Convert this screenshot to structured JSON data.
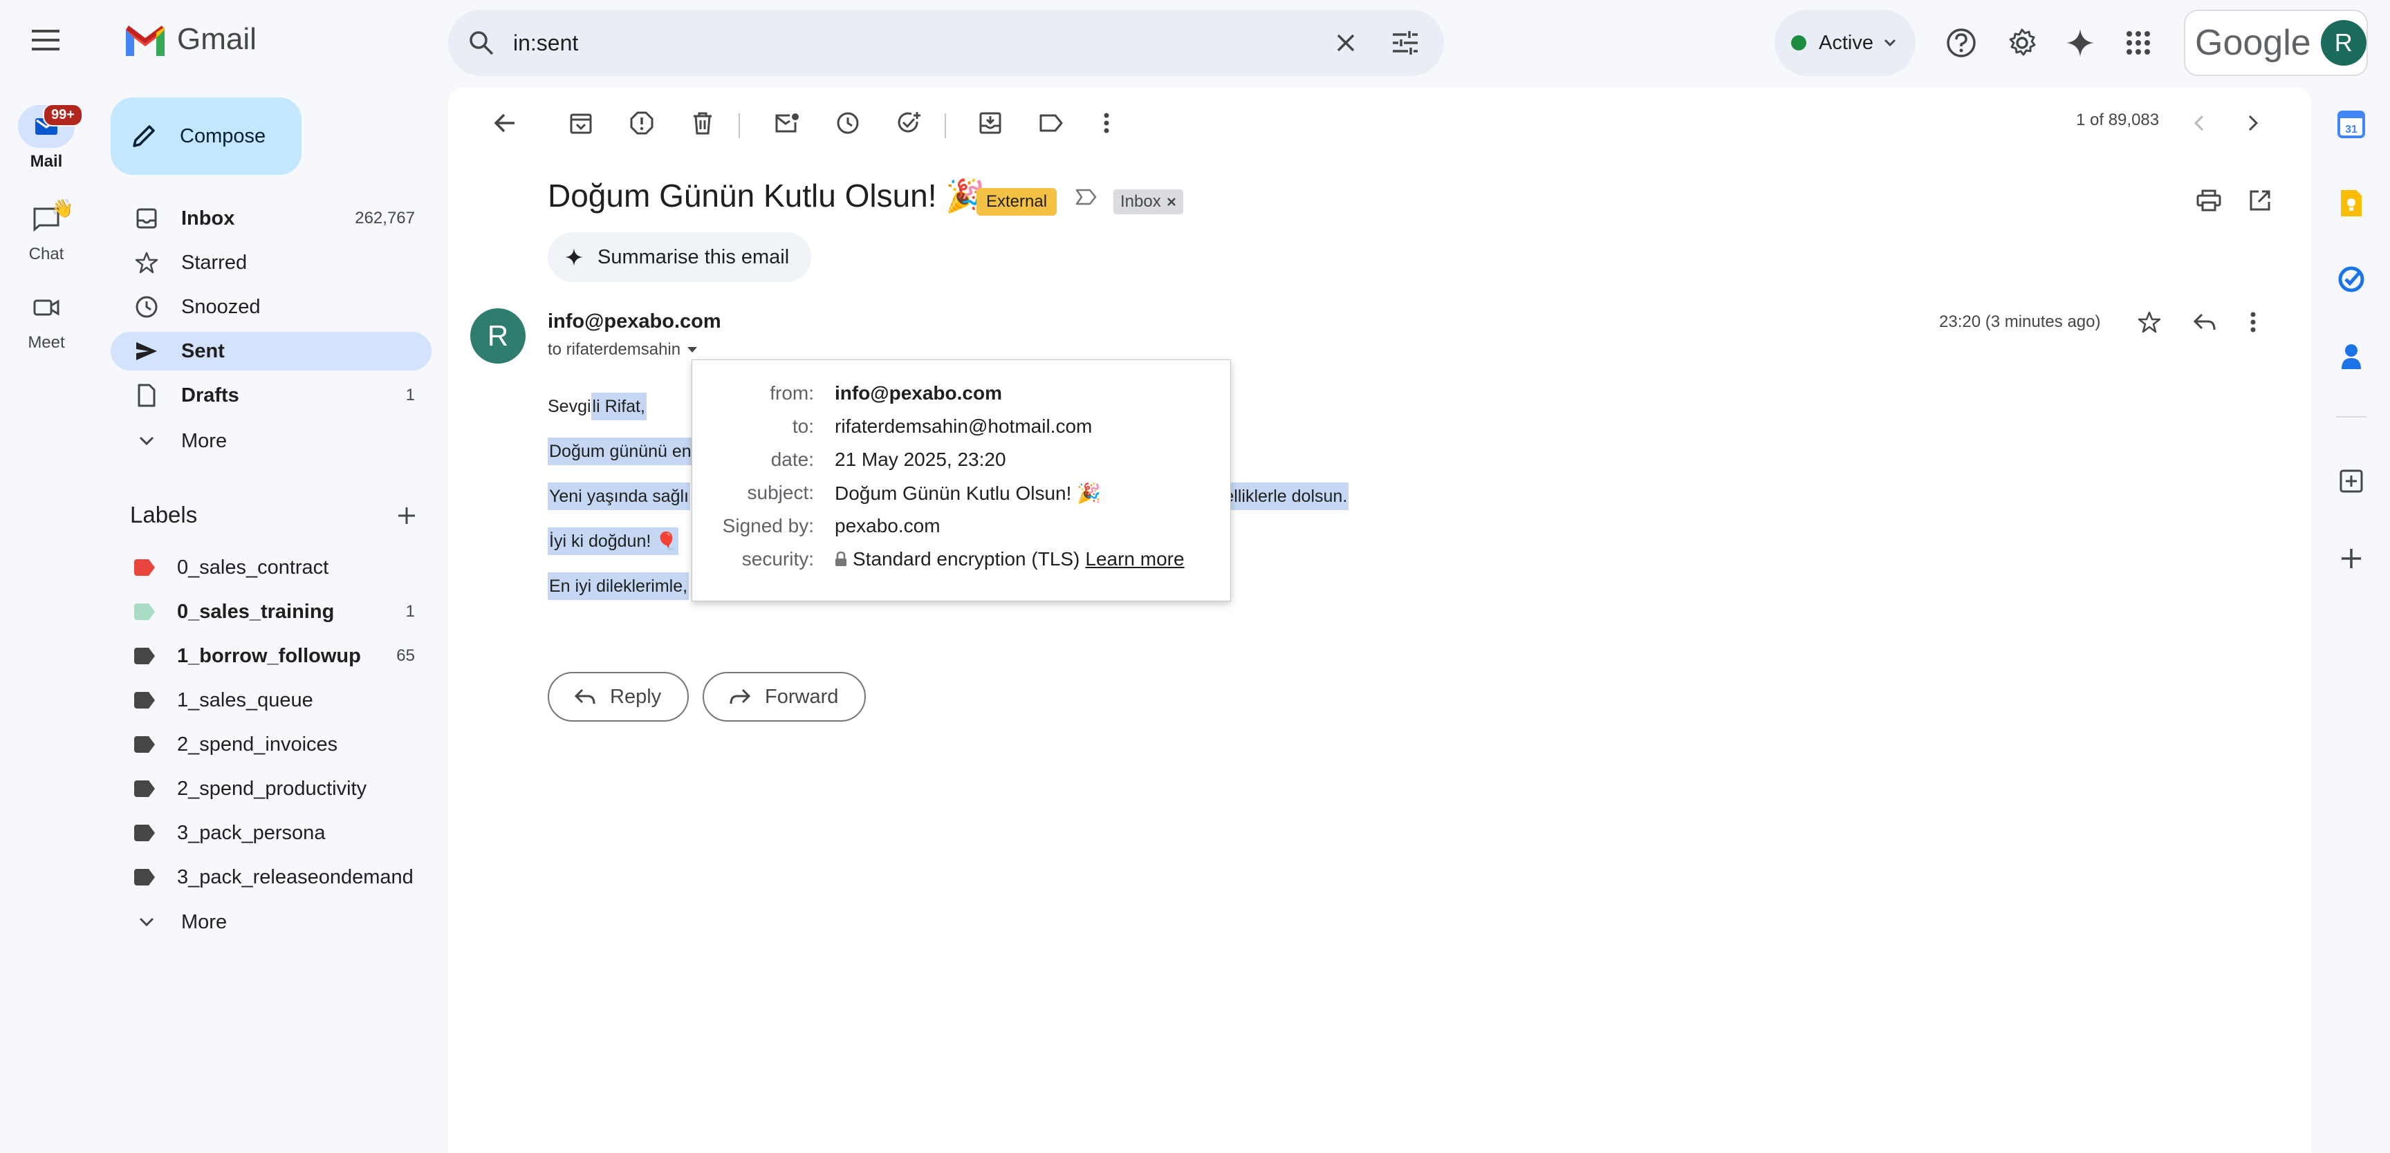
{
  "app": {
    "name": "Gmail",
    "account_initial": "R",
    "google_wordmark": "Google"
  },
  "rail": {
    "mail": {
      "label": "Mail",
      "badge": "99+"
    },
    "chat": {
      "label": "Chat"
    },
    "meet": {
      "label": "Meet"
    }
  },
  "sidebar": {
    "compose_label": "Compose",
    "items": [
      {
        "label": "Inbox",
        "count": "262,767"
      },
      {
        "label": "Starred",
        "count": ""
      },
      {
        "label": "Snoozed",
        "count": ""
      },
      {
        "label": "Sent",
        "count": ""
      },
      {
        "label": "Drafts",
        "count": "1"
      },
      {
        "label": "More",
        "count": ""
      }
    ],
    "labels_heading": "Labels",
    "labels": [
      {
        "name": "0_sales_contract",
        "count": "",
        "color": "#e8453c"
      },
      {
        "name": "0_sales_training",
        "count": "1",
        "color": "#a8dcc4"
      },
      {
        "name": "1_borrow_followup",
        "count": "65",
        "color": "#444746"
      },
      {
        "name": "1_sales_queue",
        "count": "",
        "color": "#444746"
      },
      {
        "name": "2_spend_invoices",
        "count": "",
        "color": "#444746"
      },
      {
        "name": "2_spend_productivity",
        "count": "",
        "color": "#444746"
      },
      {
        "name": "3_pack_persona",
        "count": "",
        "color": "#444746"
      },
      {
        "name": "3_pack_releaseondemand",
        "count": "",
        "color": "#444746"
      }
    ],
    "labels_more": "More"
  },
  "search": {
    "value": "in:sent"
  },
  "status": {
    "label": "Active",
    "color": "#1e8e3e"
  },
  "toolbar": {
    "pagination": "1 of 89,083"
  },
  "email": {
    "subject": "Doğum Günün Kutlu Olsun! 🎉",
    "badge_external": "External",
    "badge_inbox": "Inbox",
    "summarise_label": "Summarise this email",
    "sender": "info@pexabo.com",
    "to_line": "to rifaterdemsahin",
    "time": "23:20 (3 minutes ago)",
    "body": [
      {
        "plain": "Sevgi",
        "highlight": "li Rifat,"
      },
      {
        "plain": "",
        "highlight": "Doğum gününü en"
      },
      {
        "plain": "",
        "highlight": "Yeni yaşında sağlı",
        "tail": "üzelliklerle dolsun."
      },
      {
        "plain": "",
        "highlight": "İyi ki doğdun! 🎈"
      },
      {
        "plain": "",
        "highlight": "En iyi dileklerimle,"
      }
    ],
    "details": {
      "from_key": "from:",
      "from": "info@pexabo.com",
      "to_key": "to:",
      "to": "rifaterdemsahin@hotmail.com",
      "date_key": "date:",
      "date": "21 May 2025, 23:20",
      "subject_key": "subject:",
      "subject": "Doğum Günün Kutlu Olsun! 🎉",
      "signed_key": "Signed by:",
      "signed": "pexabo.com",
      "security_key": "security:",
      "security": "Standard encryption (TLS)",
      "learn_more": "Learn more"
    },
    "reply_label": "Reply",
    "forward_label": "Forward"
  }
}
